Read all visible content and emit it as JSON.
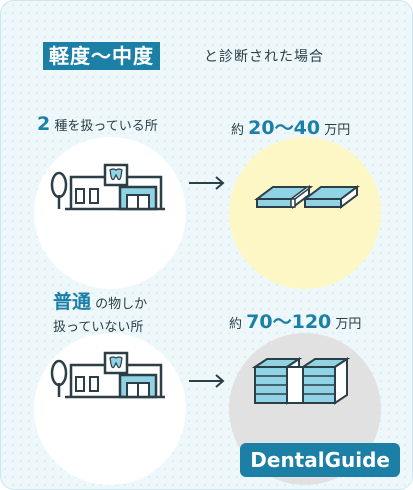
{
  "headline": {
    "highlight": "軽度〜中度",
    "suffix": "と診断された場合"
  },
  "scenario1": {
    "caption_number": "2",
    "caption_text": "種を扱っている所",
    "cost_prefix": "約",
    "cost_value": "20〜40",
    "cost_unit": "万円"
  },
  "scenario2": {
    "caption_accent": "普通",
    "caption_line1": "の物しか",
    "caption_line2": "扱っていない所",
    "cost_prefix": "約",
    "cost_value": "70〜120",
    "cost_unit": "万円"
  },
  "brand": {
    "logo_text": "DentalGuide"
  },
  "icons": {
    "clinic": "clinic-building-icon",
    "arrow": "arrow-right-icon",
    "money": "money-bundle-icon"
  },
  "colors": {
    "accent": "#1c7fa6",
    "icon_fill": "#8fd3e5",
    "yellow_circle": "#fdf7c6",
    "gray_circle": "#e1e1e1"
  }
}
